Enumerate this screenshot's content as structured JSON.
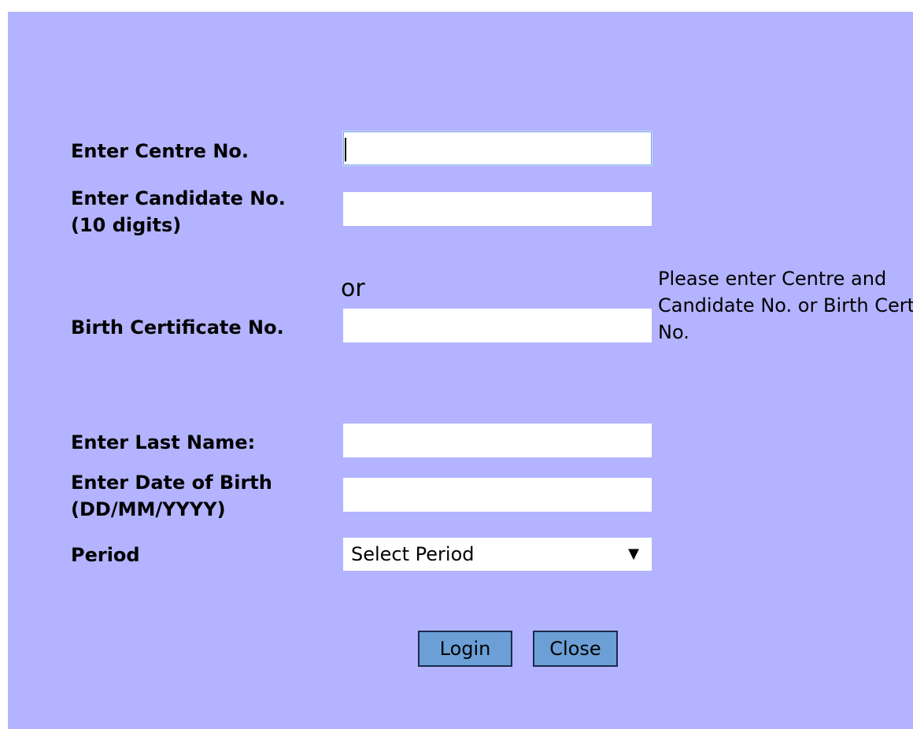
{
  "form": {
    "centre_label": "Enter Centre No.",
    "candidate_label_line1": "Enter Candidate No.",
    "candidate_label_line2": "(10 digits)",
    "or_text": "or",
    "birth_cert_label": "Birth Certificate No.",
    "hint_text": "Please enter Centre and Candidate No. or Birth Certificate No.",
    "last_name_label": "Enter Last Name:",
    "dob_label_line1": "Enter Date of Birth",
    "dob_label_line2": "(DD/MM/YYYY)",
    "period_label": "Period",
    "period_selected": "Select Period",
    "centre_value": "",
    "candidate_value": "",
    "birth_cert_value": "",
    "last_name_value": "",
    "dob_value": ""
  },
  "buttons": {
    "login_label": "Login",
    "close_label": "Close"
  },
  "colors": {
    "panel_background": "#b3b3ff",
    "button_background": "#6b9fd6"
  }
}
